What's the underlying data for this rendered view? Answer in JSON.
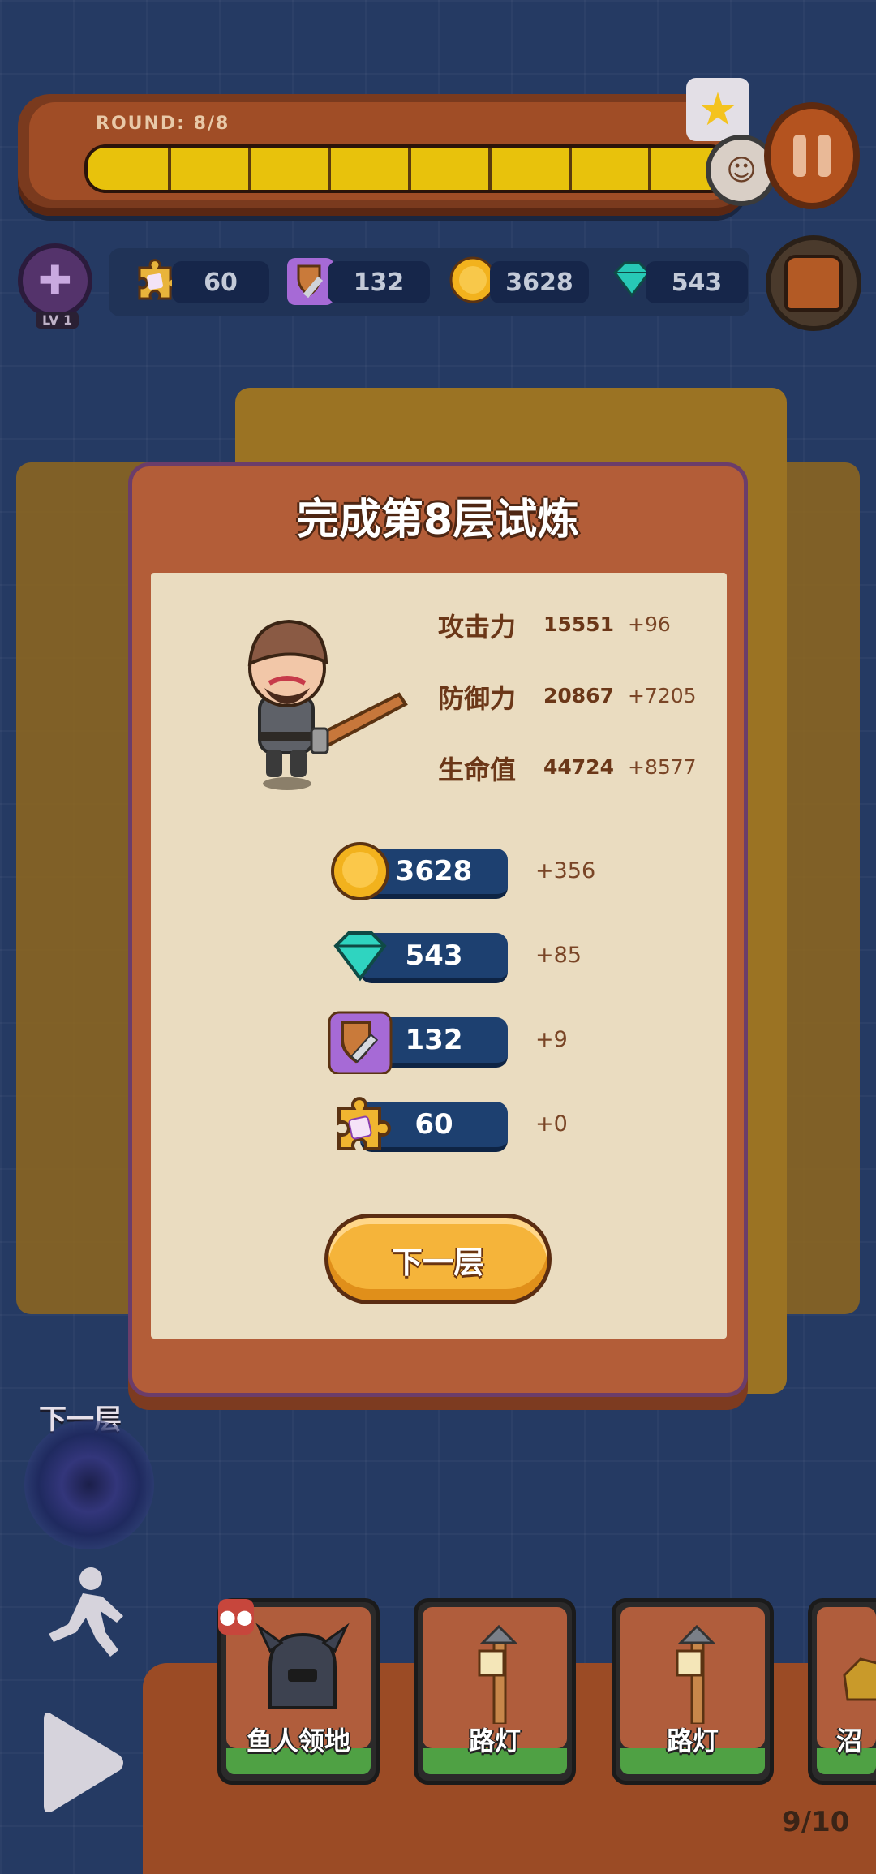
{
  "hud": {
    "round_label": "ROUND: 8/8",
    "round_progress": 1.0,
    "round_segments": 8,
    "level_badge": "LV 1",
    "resources": [
      {
        "icon": "puzzle-ticket-icon",
        "value": "60"
      },
      {
        "icon": "shield-sword-icon",
        "value": "132"
      },
      {
        "icon": "gold-coin-icon",
        "value": "3628"
      },
      {
        "icon": "gem-icon",
        "value": "543"
      }
    ]
  },
  "dialog": {
    "title": "完成第8层试炼",
    "stats": [
      {
        "label": "攻击力",
        "value": "15551",
        "delta": "+96"
      },
      {
        "label": "防御力",
        "value": "20867",
        "delta": "+7205"
      },
      {
        "label": "生命值",
        "value": "44724",
        "delta": "+8577"
      }
    ],
    "rewards": [
      {
        "icon": "gold-coin-icon",
        "value": "3628",
        "delta": "+356"
      },
      {
        "icon": "gem-icon",
        "value": "543",
        "delta": "+85"
      },
      {
        "icon": "shield-sword-icon",
        "value": "132",
        "delta": "+9"
      },
      {
        "icon": "puzzle-ticket-icon",
        "value": "60",
        "delta": "+0"
      }
    ],
    "next_button": "下一层"
  },
  "left_controls": {
    "next_floor_label": "下一层"
  },
  "cards": [
    {
      "label": "鱼人领地",
      "icon": "helmet-icon"
    },
    {
      "label": "路灯",
      "icon": "street-lamp-icon"
    },
    {
      "label": "路灯",
      "icon": "street-lamp-icon"
    },
    {
      "label": "沼",
      "icon": "gold-rock-icon"
    }
  ],
  "page_count": "9/10",
  "colors": {
    "background": "#253a63",
    "dialog": "#b35d38",
    "paper": "#eadcc0",
    "button": "#f5b43a",
    "pill": "#1d4070"
  }
}
